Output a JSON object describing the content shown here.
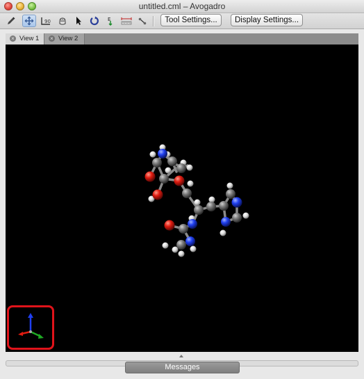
{
  "window": {
    "title": "untitled.cml – Avogadro"
  },
  "toolbar": {
    "tools": [
      {
        "name": "draw-tool-icon",
        "active": false
      },
      {
        "name": "navigate-tool-icon",
        "active": true
      },
      {
        "name": "bond-centric-tool-icon",
        "active": false
      },
      {
        "name": "manipulate-tool-icon",
        "active": false
      },
      {
        "name": "select-tool-icon",
        "active": false
      },
      {
        "name": "auto-rotate-tool-icon",
        "active": false
      },
      {
        "name": "auto-optimize-tool-icon",
        "active": false
      },
      {
        "name": "measure-tool-icon",
        "active": false
      },
      {
        "name": "align-tool-icon",
        "active": false
      }
    ],
    "tool_settings_label": "Tool Settings...",
    "display_settings_label": "Display Settings..."
  },
  "tabs": [
    {
      "label": "View 1",
      "active": true
    },
    {
      "label": "View 2",
      "active": false
    }
  ],
  "viewport": {
    "background": "#000000",
    "atom_colors": {
      "carbon": "#7a7a7a",
      "oxygen": "#e01b10",
      "nitrogen": "#1f3ff0",
      "hydrogen": "#e6e6e6"
    },
    "axes_colors": {
      "x": "#e01b10",
      "y": "#1faa24",
      "z": "#1f3ff0"
    },
    "highlight_color": "#e0131a"
  },
  "messages": {
    "label": "Messages"
  }
}
